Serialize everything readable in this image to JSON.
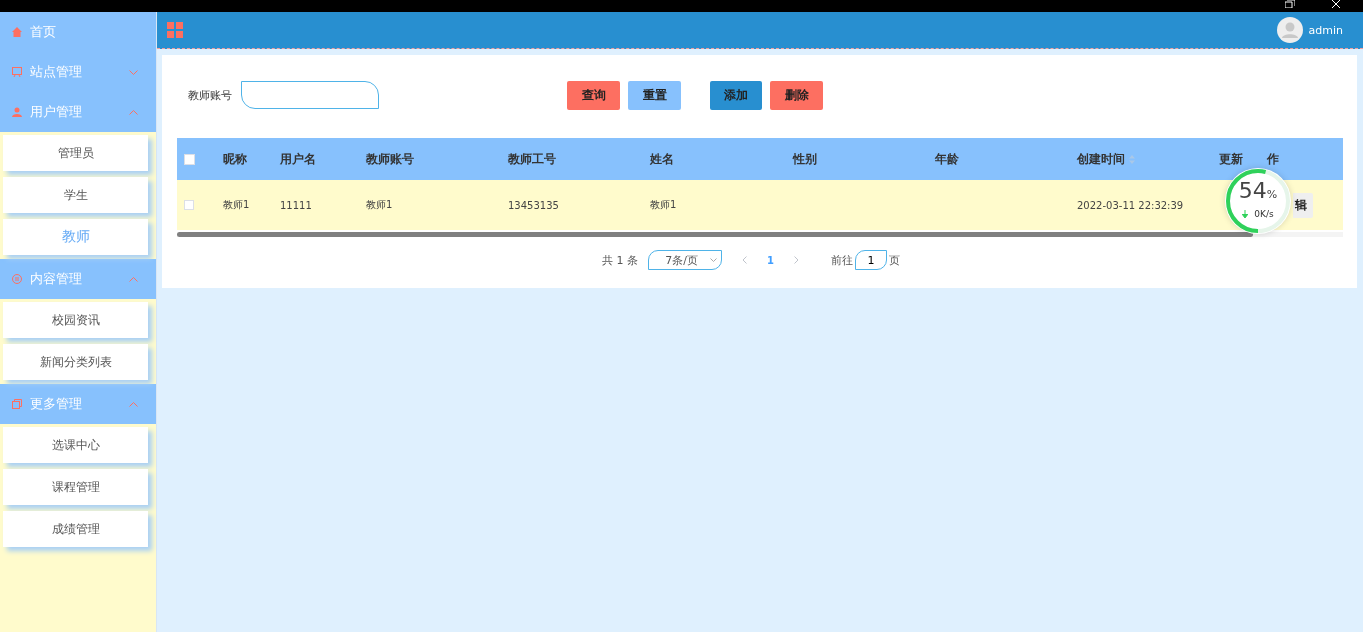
{
  "sidebar": {
    "items": [
      {
        "label": "首页"
      },
      {
        "label": "站点管理",
        "expanded": false
      },
      {
        "label": "用户管理",
        "expanded": true,
        "children": [
          {
            "label": "管理员",
            "selected": false
          },
          {
            "label": "学生",
            "selected": false
          },
          {
            "label": "教师",
            "selected": true
          }
        ]
      },
      {
        "label": "内容管理",
        "expanded": true,
        "children": [
          {
            "label": "校园资讯",
            "selected": false
          },
          {
            "label": "新闻分类列表",
            "selected": false
          }
        ]
      },
      {
        "label": "更多管理",
        "expanded": true,
        "children": [
          {
            "label": "选课中心",
            "selected": false
          },
          {
            "label": "课程管理",
            "selected": false
          },
          {
            "label": "成绩管理",
            "selected": false
          }
        ]
      }
    ]
  },
  "header": {
    "user": "admin"
  },
  "search": {
    "label": "教师账号"
  },
  "buttons": [
    {
      "label": "查询",
      "kind": "danger"
    },
    {
      "label": "重置",
      "kind": "light"
    },
    {
      "label": "添加",
      "kind": "primary"
    },
    {
      "label": "删除",
      "kind": "danger"
    }
  ],
  "table": {
    "all_checked": false,
    "columns": [
      {
        "label": "昵称",
        "sortable": false
      },
      {
        "label": "用户名",
        "sortable": false
      },
      {
        "label": "教师账号",
        "sortable": false
      },
      {
        "label": "教师工号",
        "sortable": false
      },
      {
        "label": "姓名",
        "sortable": false
      },
      {
        "label": "性别",
        "sortable": false
      },
      {
        "label": "年龄",
        "sortable": false
      },
      {
        "label": "创建时间",
        "sortable": true
      },
      {
        "label": "更新",
        "sortable": false
      },
      {
        "label": "作",
        "sortable": false
      }
    ],
    "rows": [
      {
        "checked": false,
        "cells": [
          "教师1",
          "11111",
          "教师1",
          "13453135",
          "教师1",
          null,
          null,
          "2022-03-11 22:32:39"
        ],
        "action": "辑"
      }
    ]
  },
  "pagination": {
    "total": "共 1 条",
    "page_size": "7条/页",
    "pages": [
      {
        "label": "1",
        "selected": true
      }
    ],
    "goto_label": "前往",
    "goto_value": "1",
    "goto_unit": "页"
  },
  "speed_widget": {
    "percent": "54",
    "unit": "%",
    "speed": "0K/s",
    "level": 0.54
  }
}
